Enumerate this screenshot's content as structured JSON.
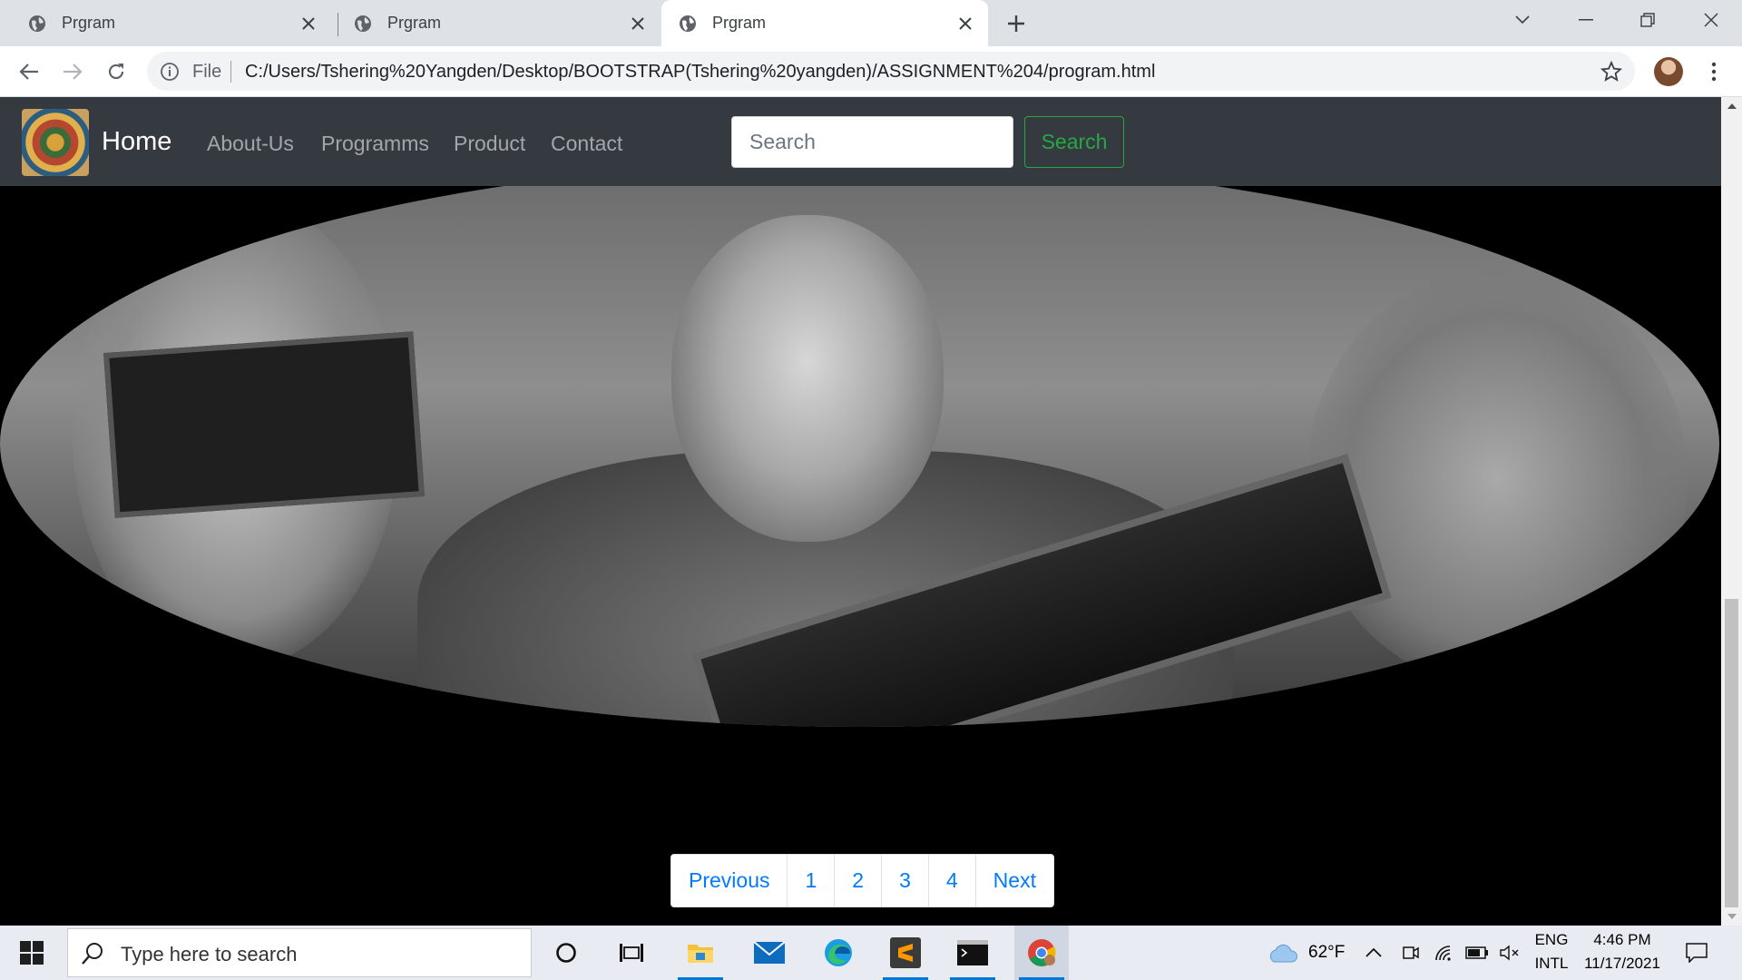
{
  "browser": {
    "tabs": [
      {
        "title": "Prgram",
        "active": false
      },
      {
        "title": "Prgram",
        "active": false
      },
      {
        "title": "Prgram",
        "active": true
      }
    ],
    "address": {
      "scheme_label": "File",
      "url": "C:/Users/Tshering%20Yangden/Desktop/BOOTSTRAP(Tshering%20yangden)/ASSIGNMENT%204/program.html"
    }
  },
  "navbar": {
    "brand": "Home",
    "links": [
      "About-Us",
      "Programms",
      "Product",
      "Contact"
    ],
    "search_placeholder": "Search",
    "search_button": "Search"
  },
  "pagination": [
    "Previous",
    "1",
    "2",
    "3",
    "4",
    "Next"
  ],
  "taskbar": {
    "search_placeholder": "Type here to search",
    "weather": "62°F",
    "lang_top": "ENG",
    "lang_bottom": "INTL",
    "time": "4:46 PM",
    "date": "11/17/2021"
  },
  "colors": {
    "navbar_bg": "#343a40",
    "search_green": "#28a745",
    "link_blue": "#007bff"
  }
}
